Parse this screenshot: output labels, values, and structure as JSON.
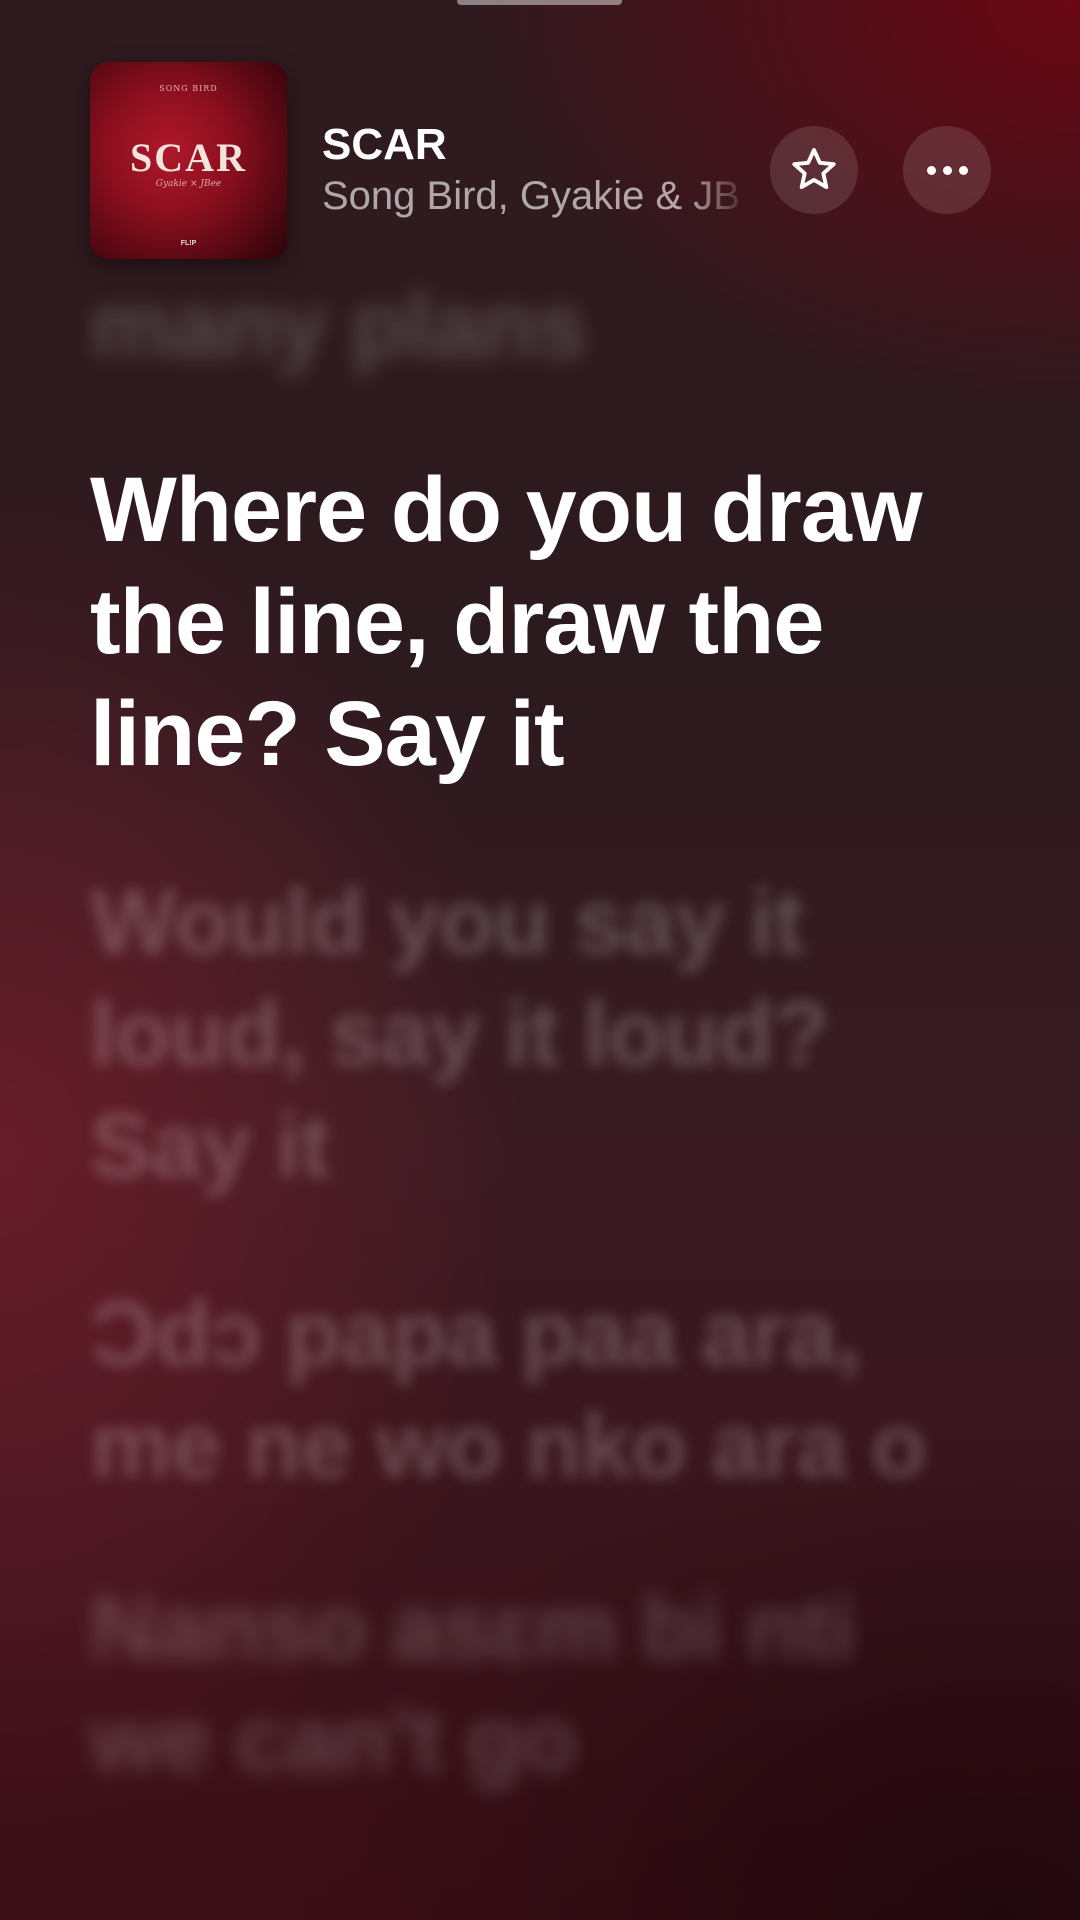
{
  "now_playing": {
    "title": "SCAR",
    "artist": "Song Bird, Gyakie & JB",
    "artwork": {
      "top_text": "SONG BIRD",
      "title": "SCAR",
      "subtitle": "Gyakie × JBee",
      "label": "FL!P"
    }
  },
  "buttons": {
    "favorite_icon": "star-outline-icon",
    "more_icon": "ellipsis-icon"
  },
  "lyrics": {
    "previous": "many plans",
    "current": "Where do you draw the line, draw the line? Say it",
    "next": [
      "Would you say it loud, say it loud? Say it",
      "Ɔdɔ papa paa ara, me ne wo nko ara o",
      "Nanso asɛm bi nti we can't go"
    ]
  },
  "colors": {
    "background_top": "#2f1a1f",
    "background_bottom": "#3b0d16",
    "accent_red": "#8a0f1e"
  }
}
